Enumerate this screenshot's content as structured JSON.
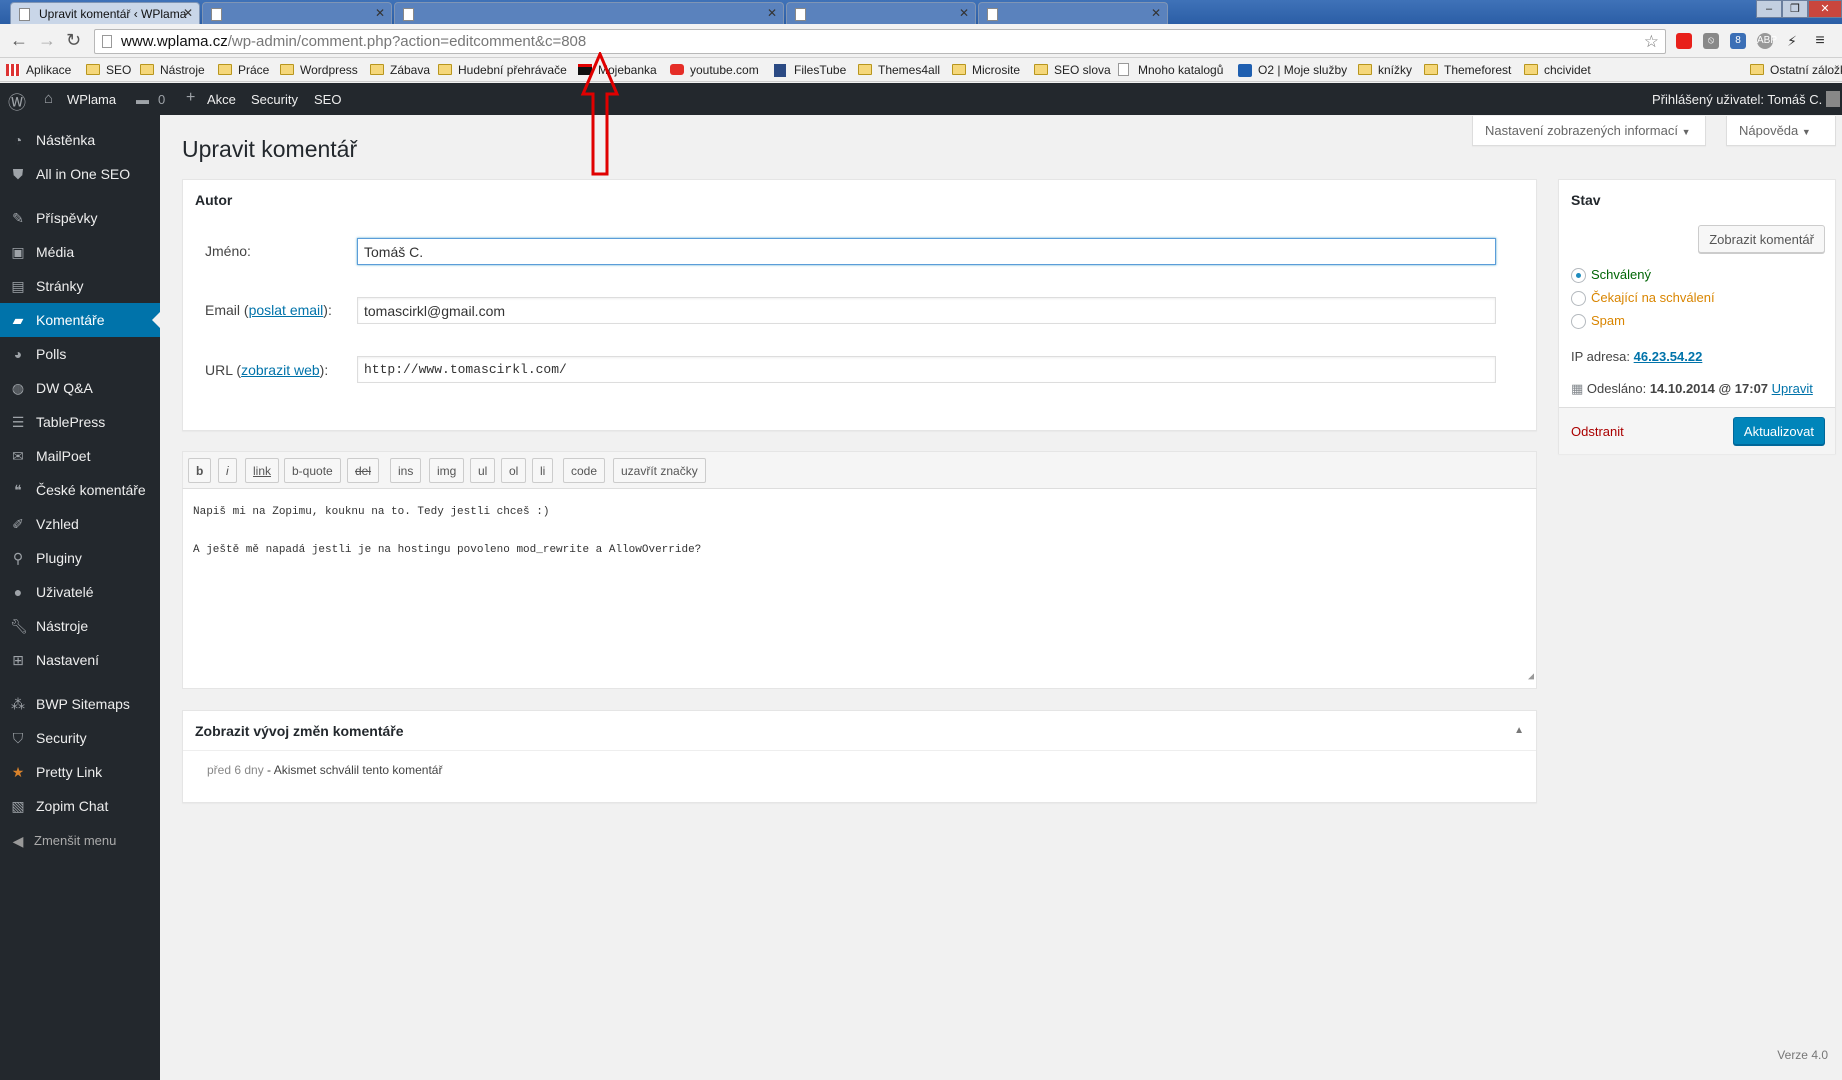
{
  "browser": {
    "tabs": [
      {
        "title": "Upravit komentář ‹ WPlama",
        "active": true
      },
      {
        "title": "",
        "active": false
      },
      {
        "title": "",
        "active": false
      },
      {
        "title": "",
        "active": false
      },
      {
        "title": "",
        "active": false
      }
    ],
    "url_host": "www.wplama.cz",
    "url_path": "/wp-admin/comment.php?action=editcomment&c=808",
    "bookmarks": [
      {
        "label": "Aplikace",
        "icon": "apps-grid-icon"
      },
      {
        "label": "SEO",
        "icon": "folder-icon"
      },
      {
        "label": "Nástroje",
        "icon": "folder-icon"
      },
      {
        "label": "Práce",
        "icon": "folder-icon"
      },
      {
        "label": "Wordpress",
        "icon": "folder-icon"
      },
      {
        "label": "Zábava",
        "icon": "folder-icon"
      },
      {
        "label": "Hudební přehrávače",
        "icon": "folder-icon"
      },
      {
        "label": "Mojebanka",
        "icon": "bank-icon"
      },
      {
        "label": "youtube.com",
        "icon": "youtube-icon"
      },
      {
        "label": "FilesTube",
        "icon": "filestube-icon"
      },
      {
        "label": "Themes4all",
        "icon": "folder-icon"
      },
      {
        "label": "Microsite",
        "icon": "folder-icon"
      },
      {
        "label": "SEO slova",
        "icon": "folder-icon"
      },
      {
        "label": "Mnoho katalogů",
        "icon": "page-icon"
      },
      {
        "label": "O2 | Moje služby",
        "icon": "o2-icon"
      },
      {
        "label": "knížky",
        "icon": "folder-icon"
      },
      {
        "label": "Themeforest",
        "icon": "folder-icon"
      },
      {
        "label": "chcividet",
        "icon": "folder-icon"
      },
      {
        "label": "Ostatní záložky",
        "icon": "folder-icon"
      }
    ]
  },
  "adminbar": {
    "site_name": "WPlama",
    "comments_count": "0",
    "new_label": "Akce",
    "security_label": "Security",
    "seo_label": "SEO",
    "user_greeting": "Přihlášený uživatel: Tomáš C."
  },
  "sidebar": {
    "items": [
      {
        "label": "Nástěnka",
        "icon": "dashboard-icon"
      },
      {
        "label": "All in One SEO",
        "icon": "shield-icon"
      },
      {
        "label": "Příspěvky",
        "icon": "pin-icon"
      },
      {
        "label": "Média",
        "icon": "media-icon"
      },
      {
        "label": "Stránky",
        "icon": "pages-icon"
      },
      {
        "label": "Komentáře",
        "icon": "comments-icon"
      },
      {
        "label": "Polls",
        "icon": "polls-icon"
      },
      {
        "label": "DW Q&A",
        "icon": "qa-icon"
      },
      {
        "label": "TablePress",
        "icon": "table-icon"
      },
      {
        "label": "MailPoet",
        "icon": "mail-icon"
      },
      {
        "label": "České komentáře",
        "icon": "speech-icon"
      },
      {
        "label": "Vzhled",
        "icon": "brush-icon"
      },
      {
        "label": "Pluginy",
        "icon": "plugin-icon"
      },
      {
        "label": "Uživatelé",
        "icon": "users-icon"
      },
      {
        "label": "Nástroje",
        "icon": "wrench-icon"
      },
      {
        "label": "Nastavení",
        "icon": "settings-icon"
      },
      {
        "label": "BWP Sitemaps",
        "icon": "sitemap-icon"
      },
      {
        "label": "Security",
        "icon": "security-icon"
      },
      {
        "label": "Pretty Link",
        "icon": "star-icon"
      },
      {
        "label": "Zopim Chat",
        "icon": "chat-icon"
      }
    ],
    "collapse_label": "Zmenšit menu",
    "active_index": 5
  },
  "screen_options": "Nastavení zobrazených informací",
  "help": "Nápověda",
  "page_title": "Upravit komentář",
  "author_box": {
    "title": "Autor",
    "name_label": "Jméno:",
    "name_value": "Tomáš C.",
    "email_label": "Email",
    "email_link": "poslat email",
    "email_suffix": "):",
    "email_value": "tomascirkl@gmail.com",
    "url_label": "URL",
    "url_link": "zobrazit web",
    "url_suffix": "):",
    "url_value": "http://www.tomascirkl.com/"
  },
  "quicktags": [
    "b",
    "i",
    "link",
    "b-quote",
    "del",
    "ins",
    "img",
    "ul",
    "ol",
    "li",
    "code",
    "uzavřít značky"
  ],
  "comment_text": [
    "Napiš mi na Zopimu, kouknu na to. Tedy jestli chceš :)",
    "",
    "A ještě mě napadá jestli je na hostingu povoleno mod_rewrite a AllowOverride?"
  ],
  "history_box": {
    "title": "Zobrazit vývoj změn komentáře",
    "time": "před 6 dny",
    "entry": " - Akismet schválil tento komentář"
  },
  "status_box": {
    "title": "Stav",
    "view_button": "Zobrazit komentář",
    "radios": [
      {
        "label": "Schválený",
        "checked": true,
        "color": "#006505"
      },
      {
        "label": "Čekající na schválení",
        "checked": false,
        "color": "#d98500"
      },
      {
        "label": "Spam",
        "checked": false,
        "color": "#d98500"
      }
    ],
    "ip_label": "IP adresa:",
    "ip_value": "46.23.54.22",
    "submitted_label": "Odesláno:",
    "submitted_value": "14.10.2014 @ 17:07",
    "edit_link": "Upravit",
    "delete_link": "Odstranit",
    "update_button": "Aktualizovat"
  },
  "footer_version": "Verze 4.0",
  "colors": {
    "admin_bar": "#23282d",
    "active_menu": "#0073aa",
    "primary_button": "#0085ba",
    "delete_link": "#a00",
    "annotation_arrow": "#e00000"
  }
}
